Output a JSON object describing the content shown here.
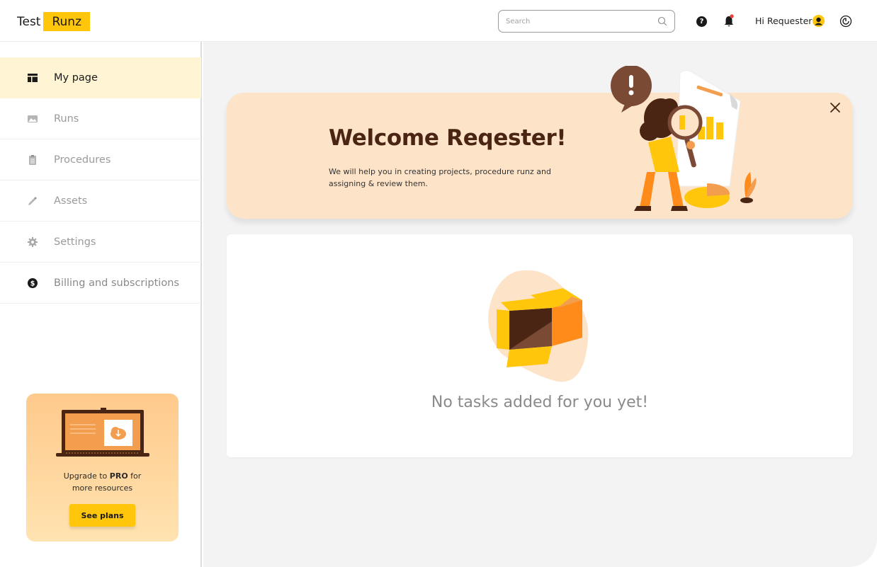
{
  "header": {
    "logo_part1": "Test",
    "logo_part2": "Runz",
    "search_placeholder": "Search",
    "greeting": "Hi Requester",
    "help_icon": "question-circle-icon",
    "notification_icon": "bell-icon",
    "logout_icon": "logout-icon"
  },
  "sidebar": {
    "items": [
      {
        "label": "My page",
        "icon": "dashboard-icon",
        "active": true
      },
      {
        "label": "Runs",
        "icon": "image-icon",
        "active": false
      },
      {
        "label": "Procedures",
        "icon": "clipboard-icon",
        "active": false
      },
      {
        "label": "Assets",
        "icon": "pipette-icon",
        "active": false
      },
      {
        "label": "Settings",
        "icon": "gear-icon",
        "active": false
      },
      {
        "label": "Billing and subscriptions",
        "icon": "dollar-circle-icon",
        "active": false
      }
    ],
    "promo": {
      "text_prefix": "Upgrade to",
      "text_bold": "PRO",
      "text_suffix": "for",
      "text_line2": "more resources",
      "button_label": "See plans"
    }
  },
  "main": {
    "welcome": {
      "title": "Welcome Reqester!",
      "subtitle": "We will help you in creating projects, procedure runz and assigning & review them."
    },
    "tasks": {
      "empty_message": "No tasks added for you yet!"
    }
  },
  "colors": {
    "brand_yellow": "#ffc60b",
    "welcome_bg": "#fde3c8",
    "active_nav_bg": "#fff4d3",
    "title_brown": "#4a2513",
    "main_bg": "#f3f3f3"
  }
}
